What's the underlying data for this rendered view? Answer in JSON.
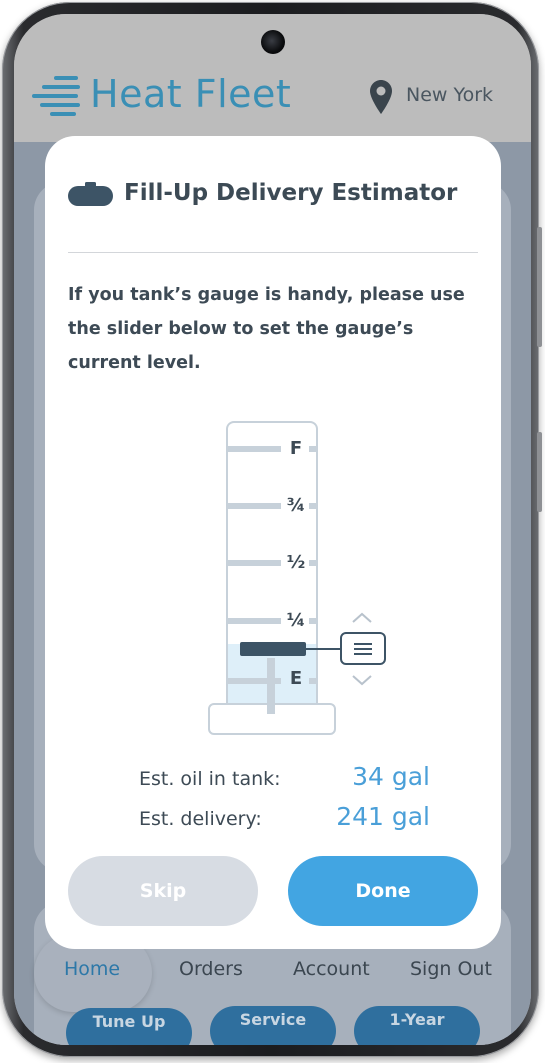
{
  "header": {
    "brand": "Heat Fleet",
    "location": "New York",
    "logo_icon": "flame-streak-icon",
    "location_icon": "map-pin-icon"
  },
  "modal": {
    "title": "Fill-Up Delivery Estimator",
    "title_icon": "oil-tank-icon",
    "instructions": "If you tank’s gauge is handy, please use the slider below to set the gauge’s current level.",
    "gauge": {
      "labels": [
        "F",
        "¾",
        "½",
        "¼",
        "E"
      ],
      "level_fraction": 0.14,
      "handle_icon": "drag-handle-icon",
      "up_icon": "chevron-up-icon",
      "down_icon": "chevron-down-icon"
    },
    "estimates": {
      "oil_label": "Est. oil in tank:",
      "oil_value": "34 gal",
      "delivery_label": "Est. delivery:",
      "delivery_value": "241 gal"
    },
    "skip_label": "Skip",
    "done_label": "Done"
  },
  "bottom_nav": {
    "items": [
      "Home",
      "Orders",
      "Account",
      "Sign Out"
    ],
    "active": "Home"
  },
  "quick_actions": [
    "Tune Up",
    "Service",
    "1-Year"
  ],
  "colors": {
    "brand_blue": "#3a8fb5",
    "accent": "#42a5e2",
    "text_dark": "#3d4a55",
    "disabled": "#d7dce3"
  }
}
